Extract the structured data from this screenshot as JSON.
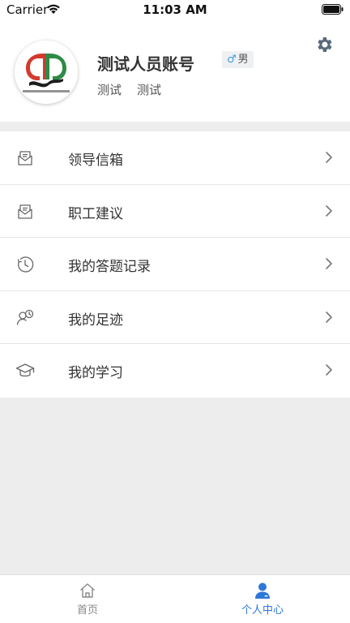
{
  "status_bar": {
    "carrier": "Carrier",
    "time": "11:03 AM"
  },
  "profile": {
    "name": "测试人员账号",
    "gender_symbol": "♂",
    "gender": "男",
    "tags": [
      "测试",
      "测试"
    ],
    "settings_icon": "gear-icon"
  },
  "menu": {
    "items": [
      {
        "label": "领导信箱",
        "icon": "mailbox-icon"
      },
      {
        "label": "职工建议",
        "icon": "mailbox-icon"
      },
      {
        "label": "我的答题记录",
        "icon": "clock-icon"
      },
      {
        "label": "我的足迹",
        "icon": "person-history-icon"
      },
      {
        "label": "我的学习",
        "icon": "graduation-cap-icon"
      }
    ]
  },
  "tab_bar": {
    "tabs": [
      {
        "label": "首页",
        "icon": "home-icon",
        "active": false
      },
      {
        "label": "个人中心",
        "icon": "user-icon",
        "active": true
      }
    ]
  },
  "colors": {
    "accent": "#2e78d6",
    "page_background": "#ededed",
    "gear": "#5a6a7c"
  }
}
